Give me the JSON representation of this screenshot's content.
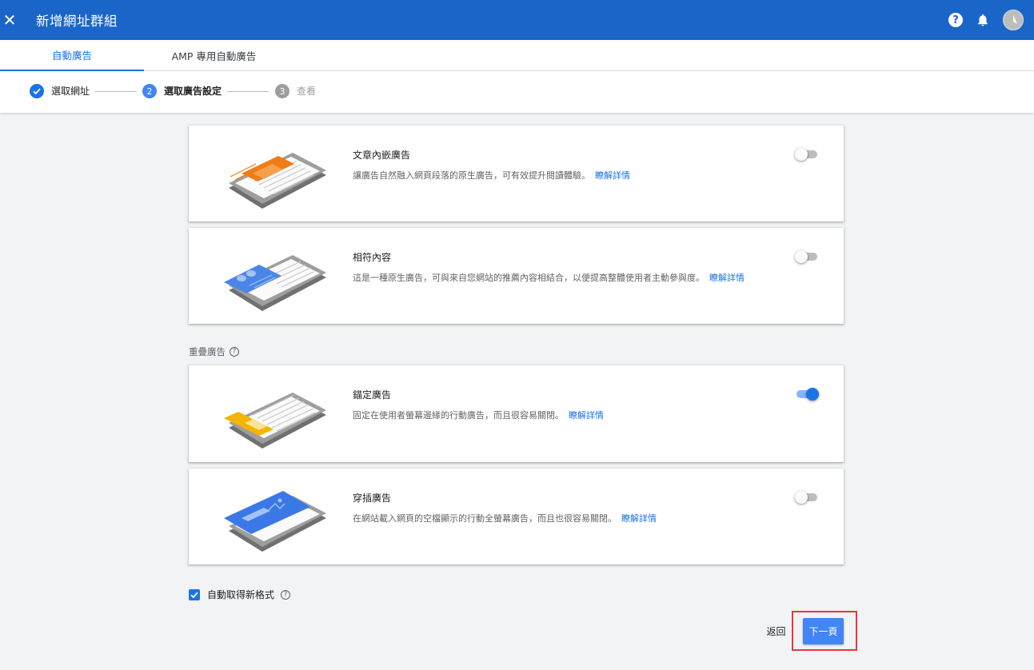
{
  "appbar": {
    "title": "新增網址群組",
    "close_glyph": "✕",
    "help_glyph": "?"
  },
  "tabs": [
    {
      "label": "自動廣告",
      "active": true
    },
    {
      "label": "AMP 專用自動廣告",
      "active": false
    }
  ],
  "stepper": {
    "steps": [
      {
        "number": "",
        "label": "選取網址",
        "state": "done"
      },
      {
        "number": "2",
        "label": "選取廣告設定",
        "state": "active"
      },
      {
        "number": "3",
        "label": "查看",
        "state": "pending"
      }
    ]
  },
  "section_overlay": {
    "label": "重疊廣告",
    "help_glyph": "?"
  },
  "cards": [
    {
      "title": "文章內嵌廣告",
      "description": "讓廣告自然融入網頁段落的原生廣告，可有效提升閱讀體驗。",
      "learn_more": "瞭解詳情",
      "enabled": false,
      "illustration": "in-article-ad-illustration"
    },
    {
      "title": "相符內容",
      "description": "這是一種原生廣告，可與來自您網站的推薦內容相結合，以便提高整體使用者主動參與度。",
      "learn_more": "瞭解詳情",
      "enabled": false,
      "illustration": "matched-content-illustration"
    },
    {
      "title": "錨定廣告",
      "description": "固定在使用者螢幕邊緣的行動廣告，而且很容易關閉。",
      "learn_more": "瞭解詳情",
      "enabled": true,
      "illustration": "anchor-ad-illustration"
    },
    {
      "title": "穿插廣告",
      "description": "在網站載入網頁的空檔顯示的行動全螢幕廣告，而且也很容易關閉。",
      "learn_more": "瞭解詳情",
      "enabled": false,
      "illustration": "vignette-ad-illustration"
    }
  ],
  "auto_new_formats": {
    "label": "自動取得新格式",
    "checked": true,
    "help_glyph": "?"
  },
  "footer": {
    "back_label": "返回",
    "next_label": "下一頁"
  },
  "colors": {
    "brand": "#1a66c8",
    "accent": "#1a73e8",
    "highlight": "#e53935"
  }
}
